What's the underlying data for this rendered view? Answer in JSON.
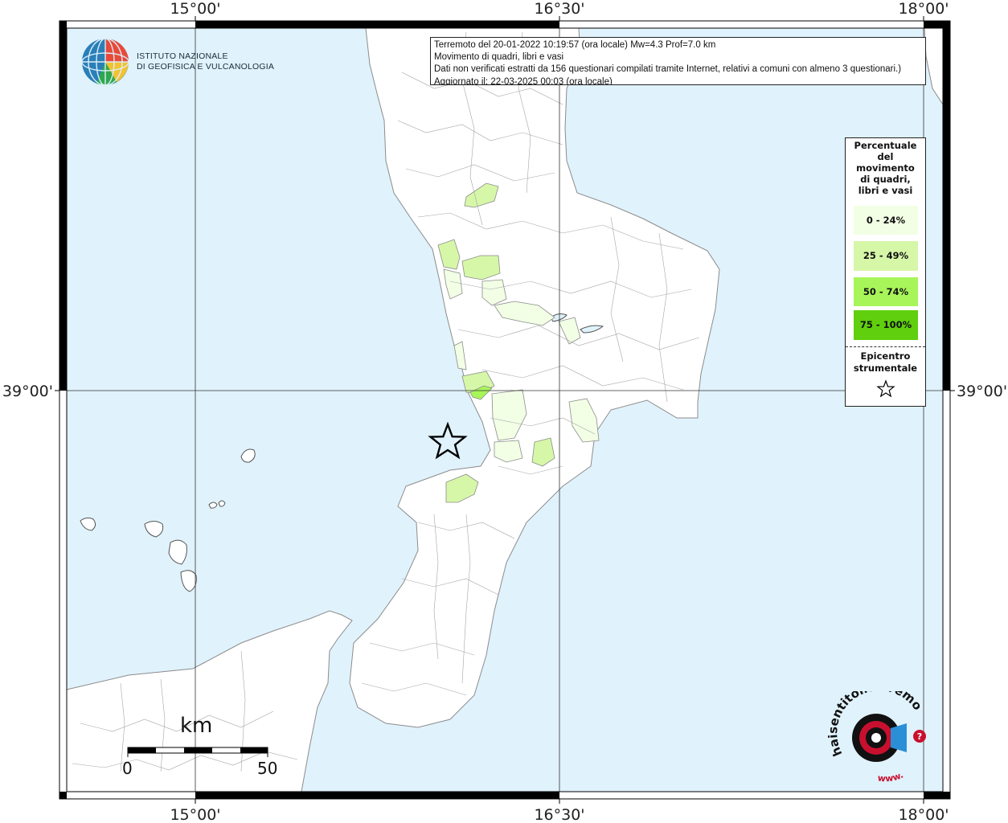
{
  "axes": {
    "top_labels": [
      "15°00'",
      "16°30'",
      "18°00'"
    ],
    "bottom_labels": [
      "15°00'",
      "16°30'",
      "18°00'"
    ],
    "left_label": "39°00'",
    "right_label": "39°00'"
  },
  "info": {
    "line1": "Terremoto del 20-01-2022 10:19:57 (ora locale) Mw=4.3 Prof=7.0 km",
    "line2": "Movimento di quadri, libri e vasi",
    "line3": "Dati non verificati estratti da 156 questionari compilati tramite Internet, relativi a comuni con almeno 3 questionari.)",
    "line4": "Aggiornato il: 22-03-2025 00:03 (ora locale)"
  },
  "legend": {
    "title_lines": [
      "Percentuale",
      "del",
      "movimento",
      "di quadri,",
      "libri e vasi"
    ],
    "classes": [
      {
        "label": "0 - 24%",
        "color": "#f2ffe5"
      },
      {
        "label": "25 - 49%",
        "color": "#d6f7a8"
      },
      {
        "label": "50 - 74%",
        "color": "#a8f55a"
      },
      {
        "label": "75 - 100%",
        "color": "#5fcf0e"
      }
    ],
    "epicenter_lines": [
      "Epicentro",
      "strumentale"
    ]
  },
  "logo": {
    "line1": "ISTITUTO NAZIONALE",
    "line2": "DI GEOFISICA E VULCANOLOGIA"
  },
  "scale": {
    "title": "km",
    "min_label": "0",
    "max_label": "50"
  },
  "hsl_logo": {
    "text": "haisentitoilterremoto.it",
    "www": "www."
  },
  "colors": {
    "sea": "#e0f2fc",
    "land": "#ffffff",
    "border": "#8c8c8c",
    "frame": "#000000"
  }
}
